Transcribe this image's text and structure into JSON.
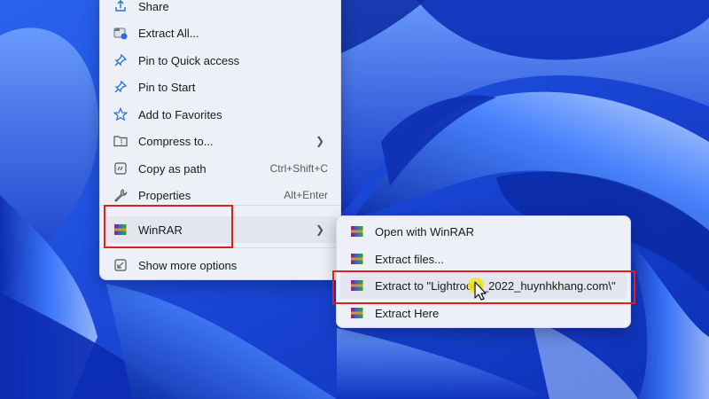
{
  "colors": {
    "wallpaper_dark": "#0a2fb8",
    "wallpaper_mid": "#1f55e0",
    "wallpaper_light": "#8fb6ff",
    "menu_bg": "#eef0f7",
    "highlight_border": "#e0201c",
    "cursor_halo": "#f2e619"
  },
  "context_menu": {
    "items": [
      {
        "label": "Share",
        "icon": "share-icon"
      },
      {
        "label": "Extract All...",
        "icon": "extract-all-icon"
      },
      {
        "label": "Pin to Quick access",
        "icon": "pin-icon"
      },
      {
        "label": "Pin to Start",
        "icon": "pin-icon"
      },
      {
        "label": "Add to Favorites",
        "icon": "star-icon"
      },
      {
        "label": "Compress to...",
        "icon": "folder-zip-icon",
        "submenu": true
      },
      {
        "label": "Copy as path",
        "icon": "copy-path-icon",
        "shortcut": "Ctrl+Shift+C"
      },
      {
        "label": "Properties",
        "icon": "wrench-icon",
        "shortcut": "Alt+Enter"
      },
      {
        "label": "WinRAR",
        "icon": "winrar-icon",
        "submenu": true
      },
      {
        "label": "Show more options",
        "icon": "more-options-icon"
      }
    ]
  },
  "winrar_submenu": {
    "items": [
      {
        "label": "Open with WinRAR",
        "icon": "winrar-icon"
      },
      {
        "label": "Extract files...",
        "icon": "winrar-icon"
      },
      {
        "label": "Extract to \"Lightroom_2022_huynhkhang.com\\\"",
        "icon": "winrar-icon"
      },
      {
        "label": "Extract Here",
        "icon": "winrar-icon"
      }
    ]
  }
}
